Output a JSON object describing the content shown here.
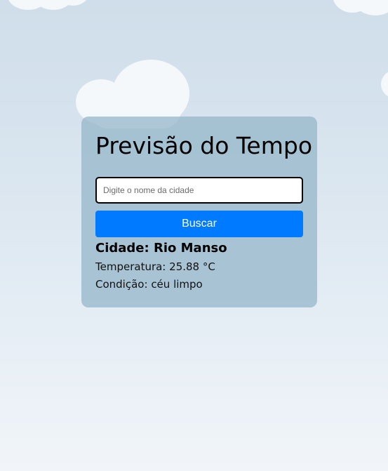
{
  "app": {
    "title": "Previsão do Tempo"
  },
  "search": {
    "placeholder": "Digite o nome da cidade",
    "value": "",
    "button_label": "Buscar"
  },
  "result": {
    "city_label": "Cidade:",
    "city_value": "Rio Manso",
    "temperature_label": "Temperatura:",
    "temperature_value": "25.88 °C",
    "condition_label": "Condição:",
    "condition_value": "céu limpo"
  },
  "colors": {
    "button": "#007bff",
    "cloud": "#f4f8fb"
  }
}
